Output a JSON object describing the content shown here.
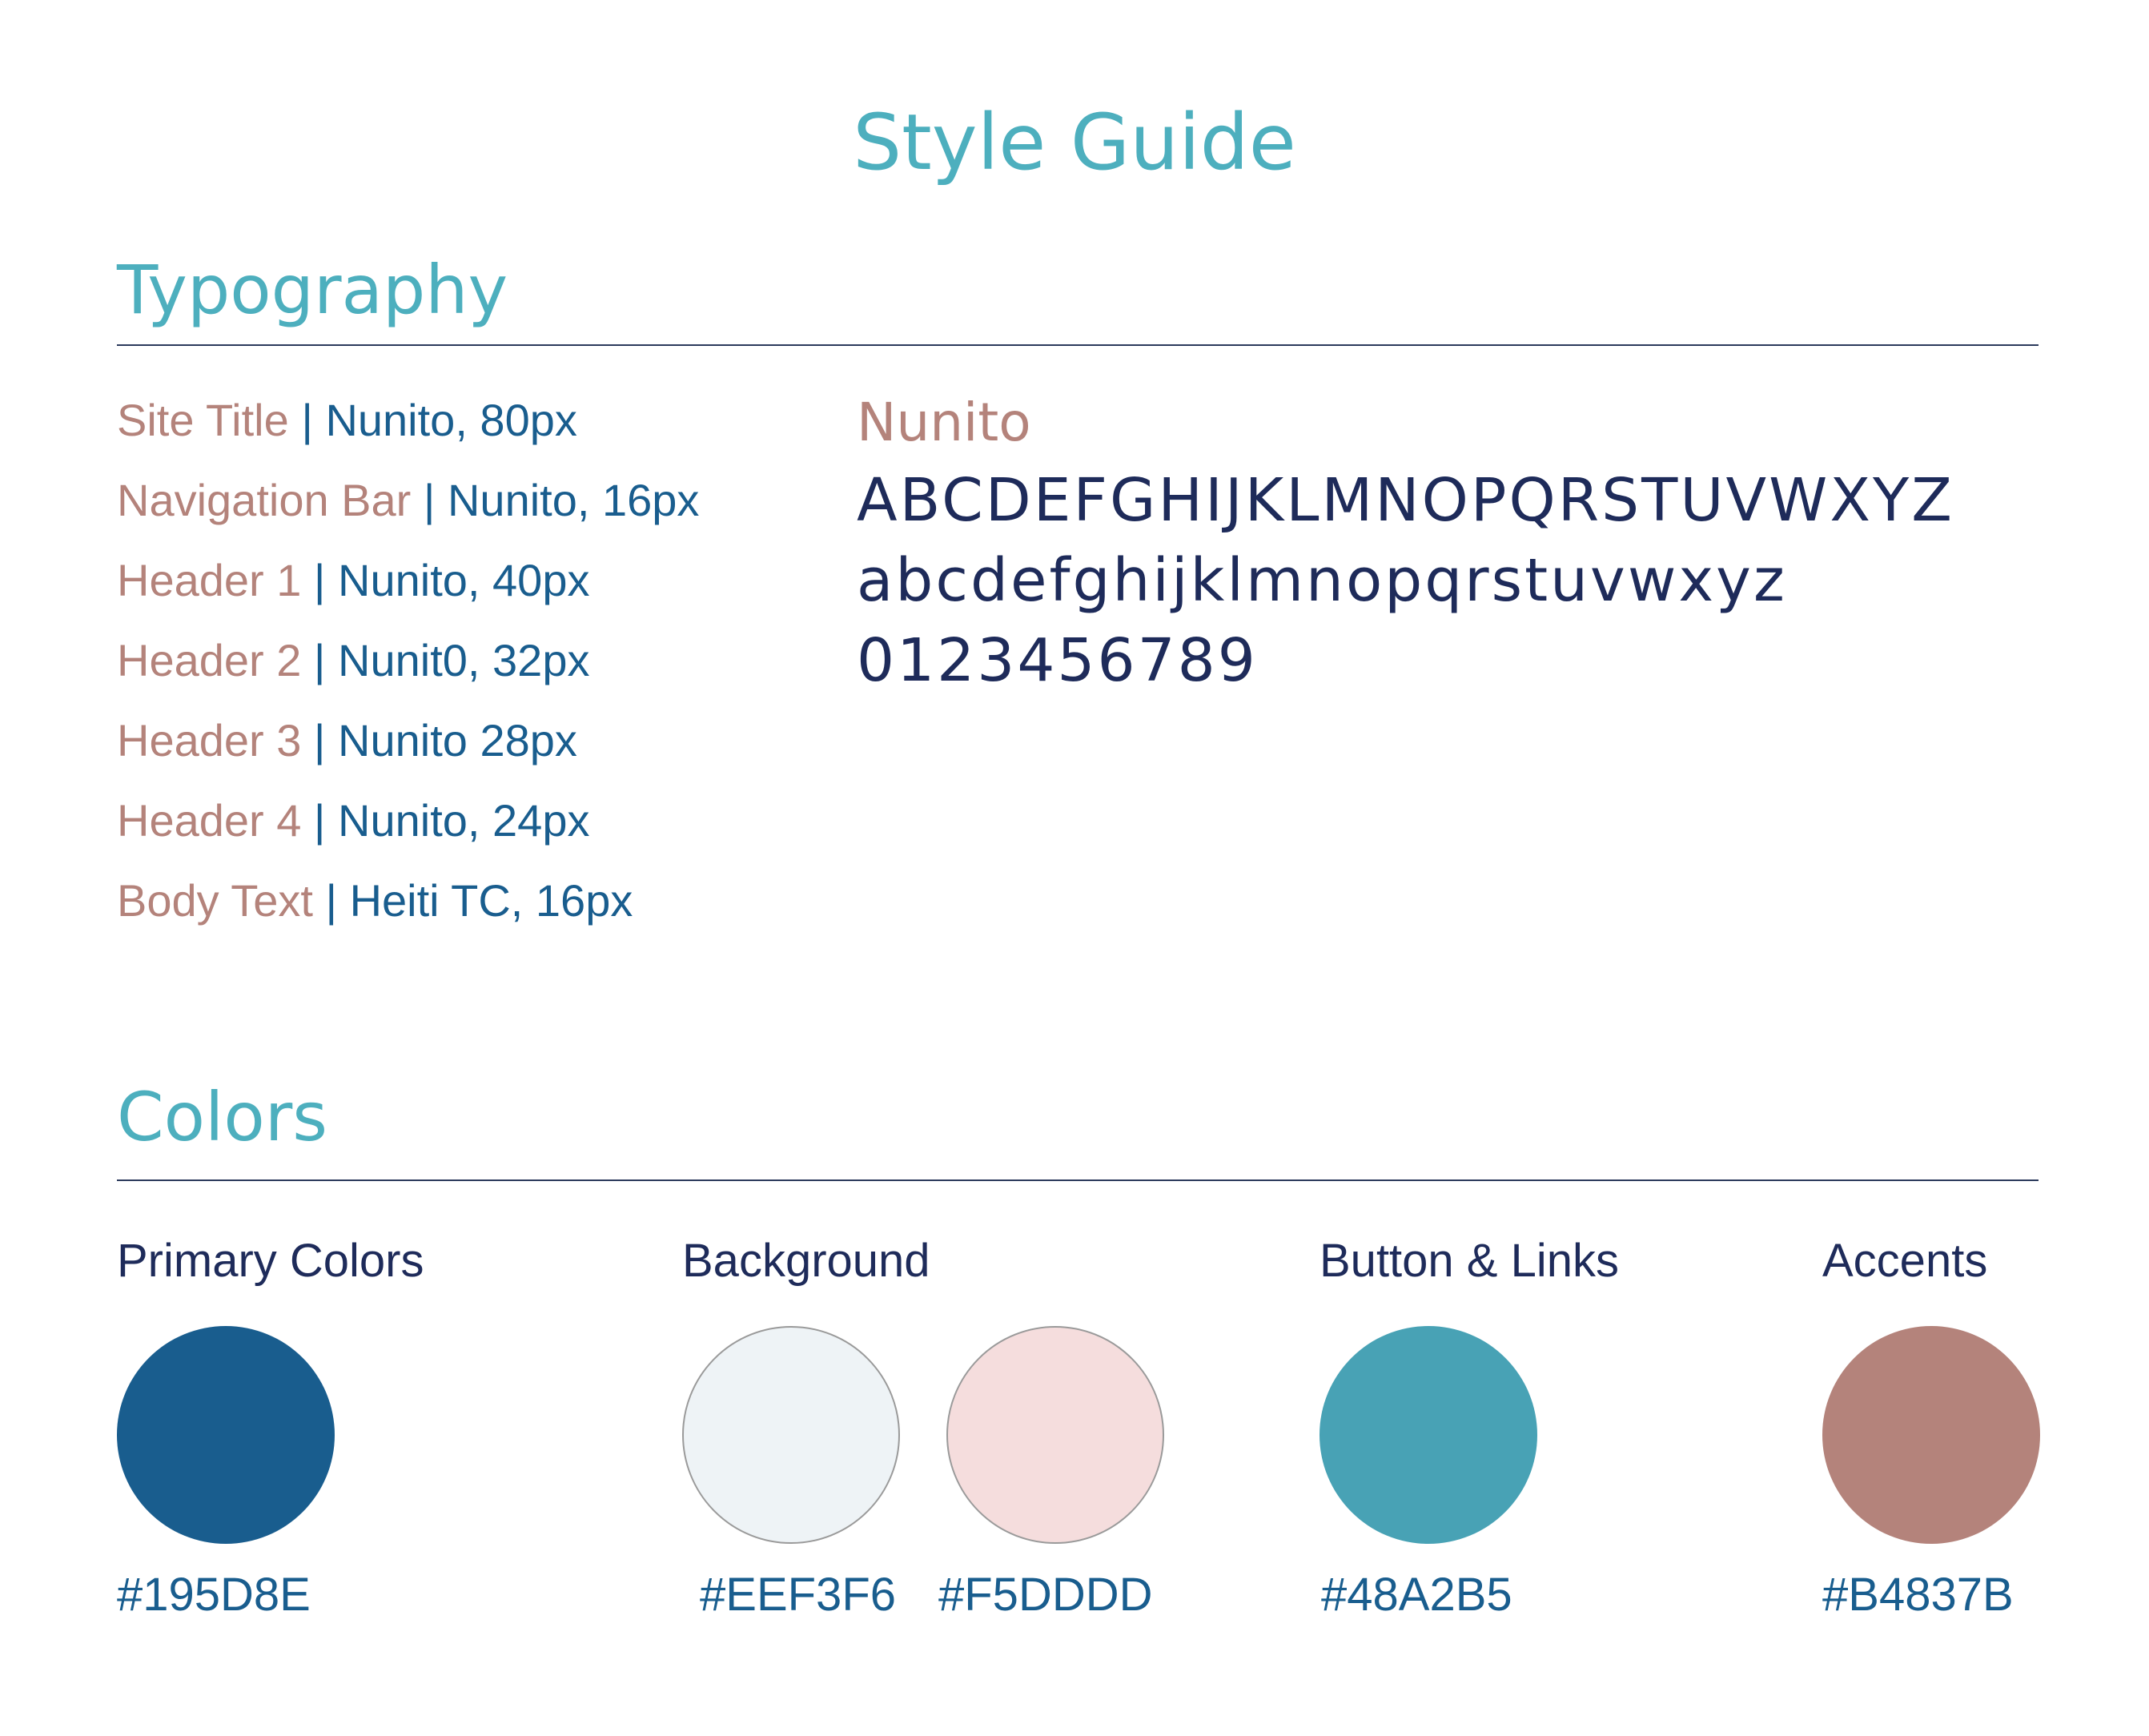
{
  "page": {
    "title": "Style Guide"
  },
  "typography": {
    "section_title": "Typography",
    "rows": [
      {
        "label": "Site Title",
        "sep": " | ",
        "spec": "Nunito, 80px"
      },
      {
        "label": "Navigation Bar",
        "sep": " | ",
        "spec": "Nunito, 16px"
      },
      {
        "label": "Header 1",
        "sep": " | ",
        "spec": "Nunito, 40px"
      },
      {
        "label": "Header 2",
        "sep": " | ",
        "spec": "Nunit0, 32px"
      },
      {
        "label": "Header 3",
        "sep": " | ",
        "spec": "Nunito 28px"
      },
      {
        "label": "Header 4",
        "sep": " | ",
        "spec": "Nunito, 24px"
      },
      {
        "label": "Body Text",
        "sep": " | ",
        "spec": "Heiti TC, 16px"
      }
    ],
    "specimen": {
      "name": "Nunito",
      "uppercase": "ABCDEFGHIJKLMNOPQRSTUVWXYZ",
      "lowercase": "abcdefghijklmnopqrstuvwxyz",
      "digits": "0123456789"
    }
  },
  "colors": {
    "section_title": "Colors",
    "groups": [
      {
        "label": "Primary Colors",
        "swatches": [
          {
            "hex": "#195D8E",
            "color": "#195D8E"
          }
        ]
      },
      {
        "label": "Background",
        "swatches": [
          {
            "hex": "#EEF3F6",
            "color": "#EEF3F6"
          },
          {
            "hex": "#F5DDDD",
            "color": "#F5DDDD"
          }
        ]
      },
      {
        "label": "Button & Links",
        "swatches": [
          {
            "hex": "#48A2B5",
            "color": "#48A2B5"
          }
        ]
      },
      {
        "label": "Accents",
        "swatches": [
          {
            "hex": "#B4837B",
            "color": "#B4837B"
          }
        ]
      }
    ]
  }
}
